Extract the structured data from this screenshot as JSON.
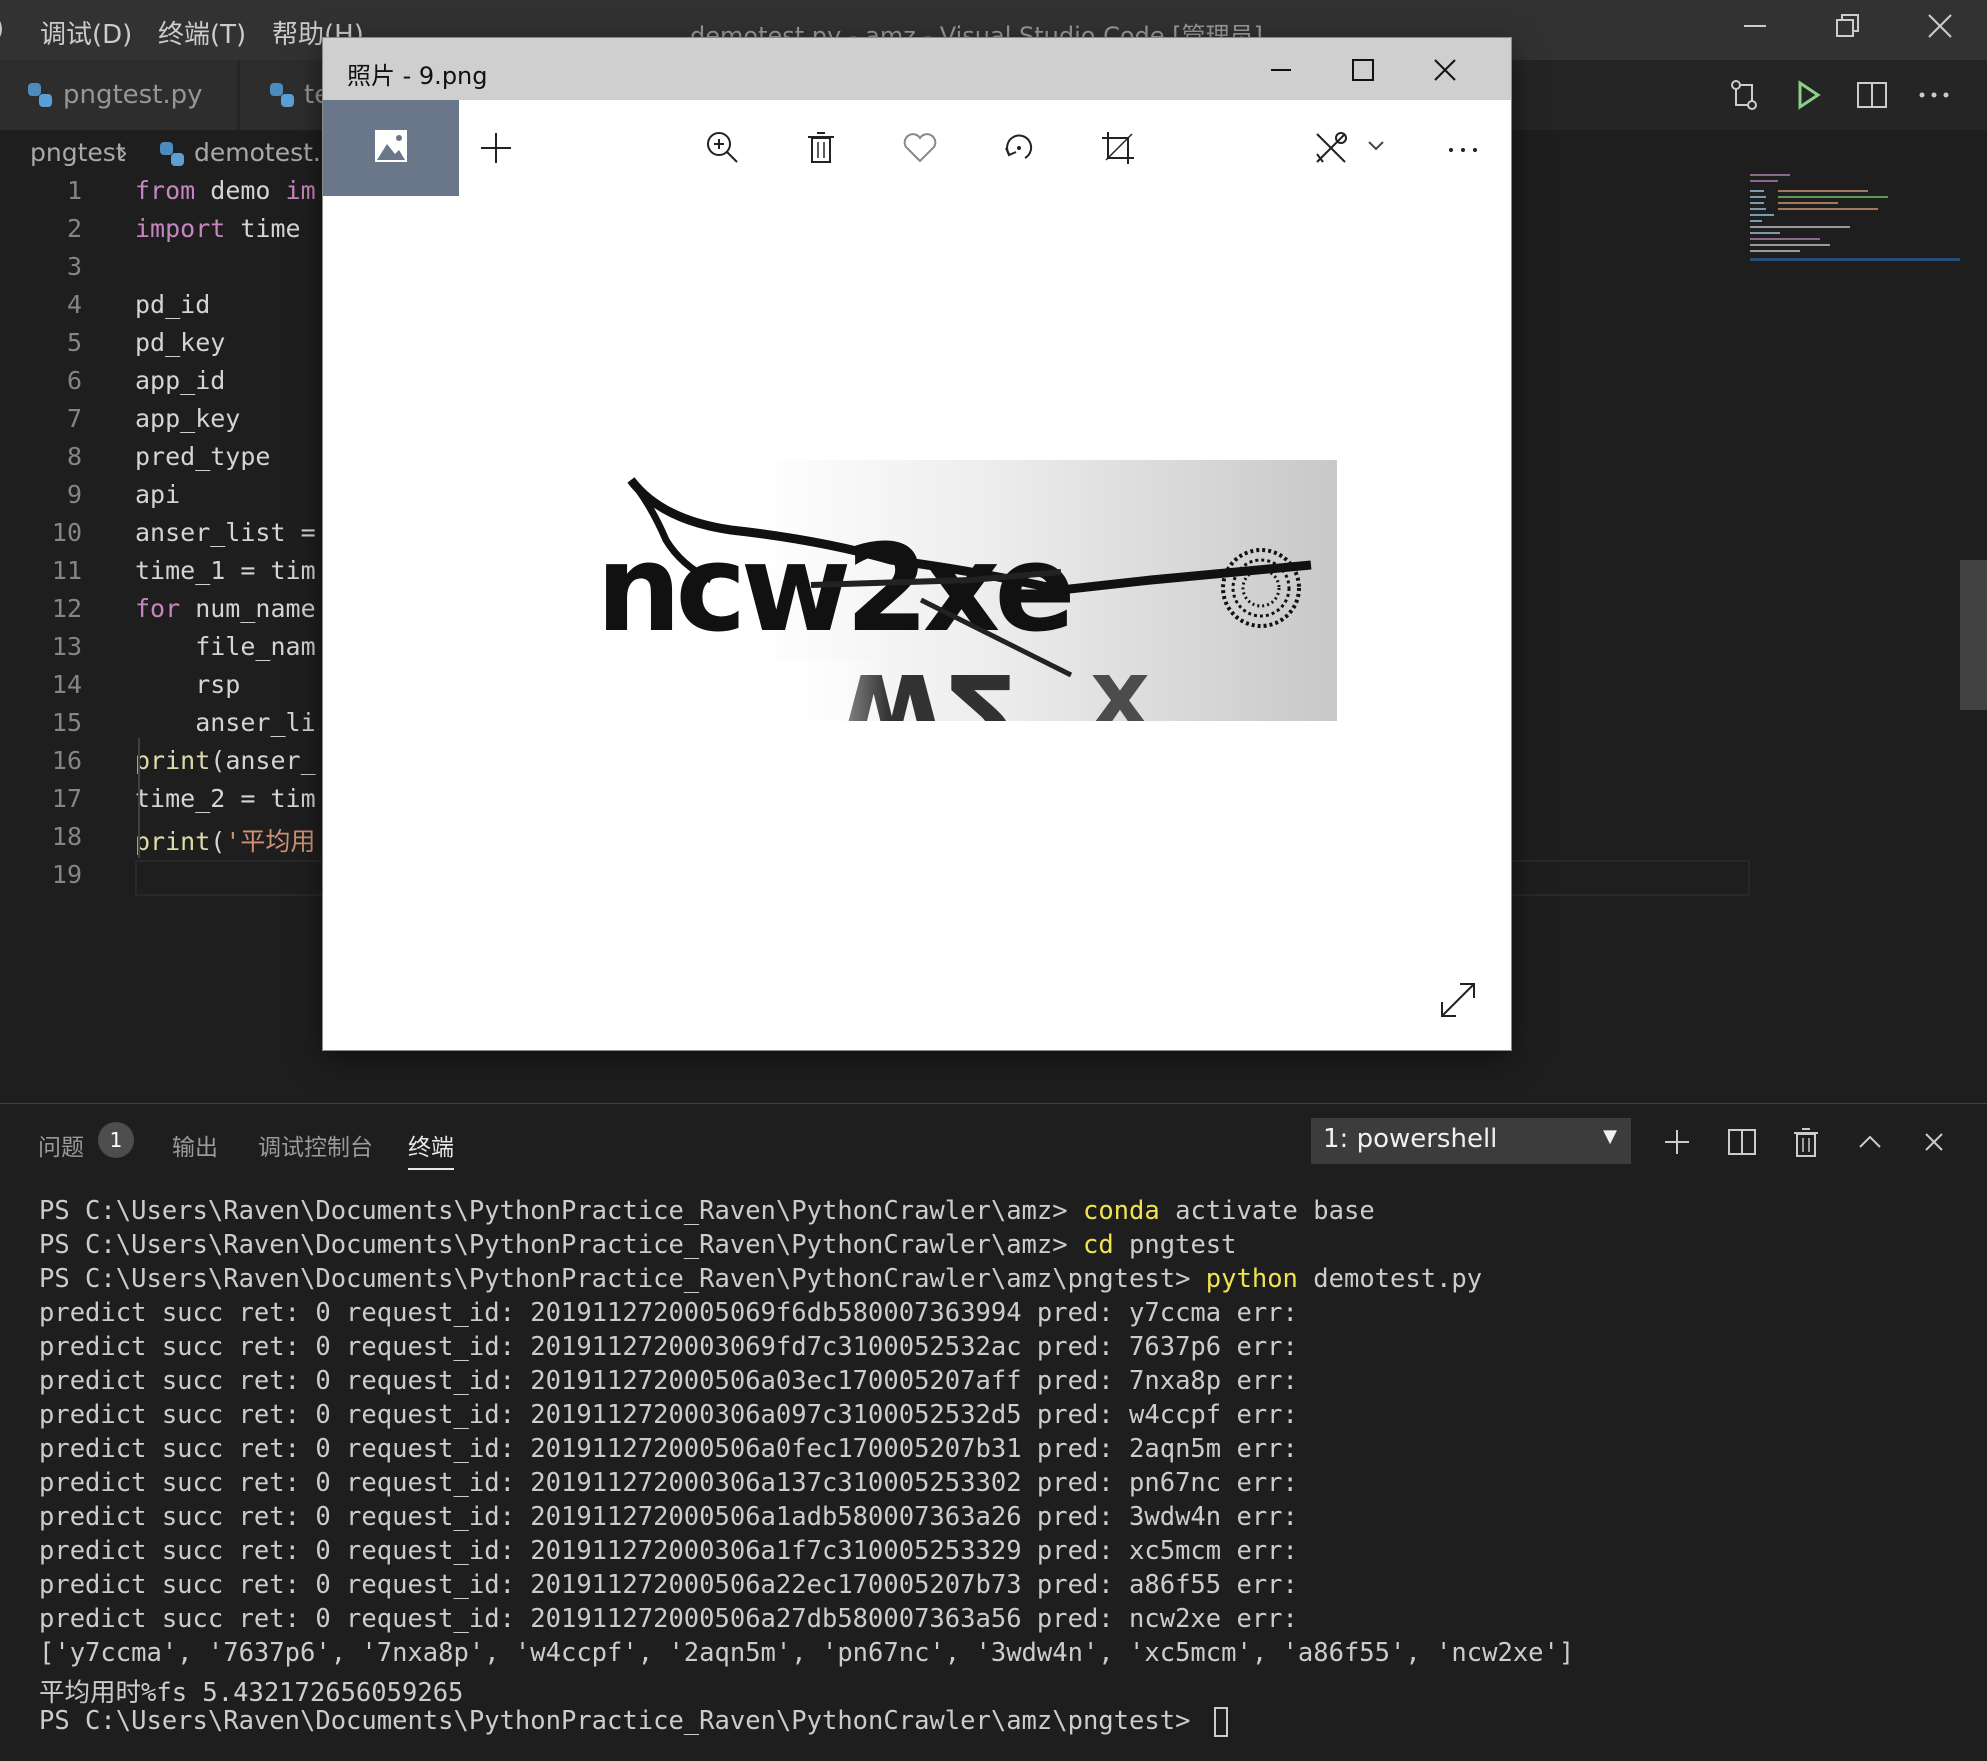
{
  "titlebar": {
    "menus": [
      "调试(D)",
      "终端(T)",
      "帮助(H)"
    ],
    "window_title": "demotest.py - amz - Visual Studio Code [管理员]"
  },
  "tabs": [
    {
      "label": "pngtest.py"
    },
    {
      "label": "te"
    }
  ],
  "breadcrumb": {
    "folder": "pngtest",
    "file": "demotest.p"
  },
  "editor": {
    "lines": [
      {
        "n": "1",
        "parts": [
          [
            "kw",
            "from"
          ],
          [
            "",
            "demo"
          ],
          [
            "kw",
            " im"
          ]
        ]
      },
      {
        "n": "2",
        "parts": [
          [
            "kw",
            "import"
          ],
          [
            "",
            " time"
          ]
        ]
      },
      {
        "n": "3",
        "parts": []
      },
      {
        "n": "4",
        "parts": [
          [
            "",
            "pd_id"
          ]
        ]
      },
      {
        "n": "5",
        "parts": [
          [
            "",
            "pd_key"
          ]
        ]
      },
      {
        "n": "6",
        "parts": [
          [
            "",
            "app_id"
          ]
        ]
      },
      {
        "n": "7",
        "parts": [
          [
            "",
            "app_key"
          ]
        ]
      },
      {
        "n": "8",
        "parts": [
          [
            "",
            "pred_type"
          ]
        ]
      },
      {
        "n": "9",
        "parts": [
          [
            "",
            "api"
          ]
        ]
      },
      {
        "n": "10",
        "parts": [
          [
            "",
            "anser_list ="
          ]
        ]
      },
      {
        "n": "11",
        "parts": [
          [
            "",
            "time_1 = tim"
          ]
        ]
      },
      {
        "n": "12",
        "parts": [
          [
            "kw",
            "for"
          ],
          [
            "",
            " num_name"
          ]
        ]
      },
      {
        "n": "13",
        "parts": [
          [
            "",
            "    file_nam"
          ]
        ]
      },
      {
        "n": "14",
        "parts": [
          [
            "",
            "    rsp"
          ]
        ]
      },
      {
        "n": "15",
        "parts": [
          [
            "",
            "    anser_li"
          ]
        ]
      },
      {
        "n": "16",
        "parts": [
          [
            "fn",
            "print"
          ],
          [
            "",
            "(anser_"
          ]
        ]
      },
      {
        "n": "17",
        "parts": [
          [
            "",
            "time_2 = tim"
          ]
        ]
      },
      {
        "n": "18",
        "parts": [
          [
            "fn",
            "print"
          ],
          [
            "",
            "("
          ],
          [
            "str",
            "'平均用"
          ]
        ]
      },
      {
        "n": "19",
        "parts": []
      }
    ]
  },
  "panel": {
    "tabs": [
      "问题",
      "输出",
      "调试控制台",
      "终端"
    ],
    "problems_count": "1",
    "terminal_select": "1: powershell"
  },
  "terminal": {
    "lines": [
      [
        [
          "",
          "PS C:\\Users\\Raven\\Documents\\PythonPractice_Raven\\PythonCrawler\\amz> "
        ],
        [
          "yel",
          "conda"
        ],
        [
          "",
          " activate base"
        ]
      ],
      [
        [
          "",
          "PS C:\\Users\\Raven\\Documents\\PythonPractice_Raven\\PythonCrawler\\amz> "
        ],
        [
          "yel",
          "cd"
        ],
        [
          "",
          " pngtest"
        ]
      ],
      [
        [
          "",
          "PS C:\\Users\\Raven\\Documents\\PythonPractice_Raven\\PythonCrawler\\amz\\pngtest> "
        ],
        [
          "yel",
          "python"
        ],
        [
          "",
          " demotest.py"
        ]
      ],
      [
        [
          "",
          "predict succ ret: 0 request_id: 2019112720005069f6db580007363994 pred: y7ccma err:"
        ]
      ],
      [
        [
          "",
          "predict succ ret: 0 request_id: 2019112720003069fd7c3100052532ac pred: 7637p6 err:"
        ]
      ],
      [
        [
          "",
          "predict succ ret: 0 request_id: 201911272000506a03ec170005207aff pred: 7nxa8p err:"
        ]
      ],
      [
        [
          "",
          "predict succ ret: 0 request_id: 201911272000306a097c3100052532d5 pred: w4ccpf err:"
        ]
      ],
      [
        [
          "",
          "predict succ ret: 0 request_id: 201911272000506a0fec170005207b31 pred: 2aqn5m err:"
        ]
      ],
      [
        [
          "",
          "predict succ ret: 0 request_id: 201911272000306a137c310005253302 pred: pn67nc err:"
        ]
      ],
      [
        [
          "",
          "predict succ ret: 0 request_id: 201911272000506a1adb580007363a26 pred: 3wdw4n err:"
        ]
      ],
      [
        [
          "",
          "predict succ ret: 0 request_id: 201911272000306a1f7c310005253329 pred: xc5mcm err:"
        ]
      ],
      [
        [
          "",
          "predict succ ret: 0 request_id: 201911272000506a22ec170005207b73 pred: a86f55 err:"
        ]
      ],
      [
        [
          "",
          "predict succ ret: 0 request_id: 201911272000506a27db580007363a56 pred: ncw2xe err:"
        ]
      ],
      [
        [
          "",
          "['y7ccma', '7637p6', '7nxa8p', 'w4ccpf', '2aqn5m', 'pn67nc', '3wdw4n', 'xc5mcm', 'a86f55', 'ncw2xe']"
        ]
      ],
      [
        [
          "",
          "平均用时%fs 5.432172656059265"
        ]
      ],
      [
        [
          "",
          "PS C:\\Users\\Raven\\Documents\\PythonPractice_Raven\\PythonCrawler\\amz\\pngtest> "
        ]
      ]
    ]
  },
  "photos": {
    "title": "照片 - 9.png",
    "captcha_text": "ncw2xe"
  },
  "colors": {
    "editor_bg": "#1e1e1e",
    "keyword": "#c586c0",
    "function": "#dcdcaa",
    "string": "#ce9178",
    "terminal_command": "#f0e44e",
    "photos_selected": "#6a7689"
  },
  "icons": [
    "python-file-icon",
    "source-control-icon",
    "run-icon",
    "split-editor-icon",
    "more-icon",
    "image-view-icon",
    "add-icon",
    "zoom-in-icon",
    "delete-icon",
    "heart-icon",
    "rotate-icon",
    "crop-icon",
    "edit-icon",
    "expand-icon",
    "add-terminal-icon",
    "trash-icon",
    "chevron-up-icon",
    "close-icon"
  ]
}
